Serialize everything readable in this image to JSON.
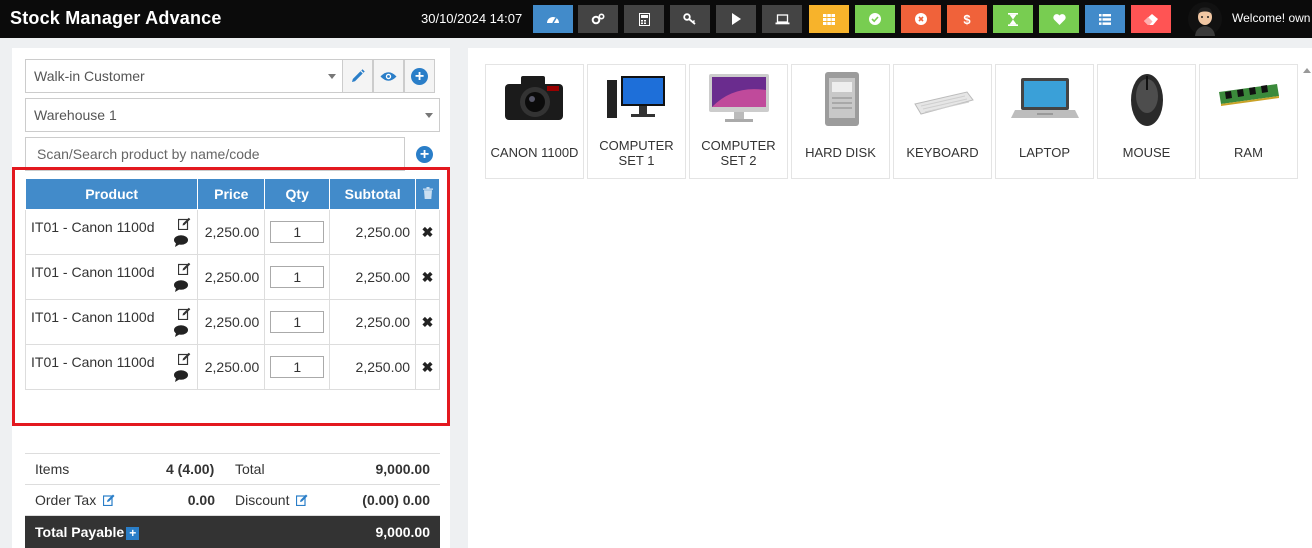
{
  "app": {
    "title": "Stock Manager Advance",
    "datetime": "30/10/2024 14:07",
    "welcome": "Welcome! own"
  },
  "toolbar": [
    {
      "icon": "dashboard-icon",
      "color": "#428bca"
    },
    {
      "icon": "cogs-icon",
      "color": "#444444"
    },
    {
      "icon": "calculator-icon",
      "color": "#444444"
    },
    {
      "icon": "key-icon",
      "color": "#444444"
    },
    {
      "icon": "play-icon",
      "color": "#444444"
    },
    {
      "icon": "laptop-icon",
      "color": "#444444"
    },
    {
      "icon": "th-icon",
      "color": "#f7b32b"
    },
    {
      "icon": "check-circle-icon",
      "color": "#78cd51"
    },
    {
      "icon": "times-circle-icon",
      "color": "#f0623a"
    },
    {
      "icon": "dollar-icon",
      "color": "#f0623a"
    },
    {
      "icon": "hourglass-icon",
      "color": "#78cd51"
    },
    {
      "icon": "heart-icon",
      "color": "#78cd51"
    },
    {
      "icon": "list-icon",
      "color": "#428bca"
    },
    {
      "icon": "eraser-icon",
      "color": "#ff5454"
    }
  ],
  "customer": {
    "value": "Walk-in Customer"
  },
  "warehouse": {
    "value": "Warehouse 1"
  },
  "search": {
    "placeholder": "Scan/Search product by name/code"
  },
  "cart": {
    "headers": {
      "product": "Product",
      "price": "Price",
      "qty": "Qty",
      "subtotal": "Subtotal"
    },
    "rows": [
      {
        "product": "IT01 - Canon 1100d",
        "price": "2,250.00",
        "qty": "1",
        "subtotal": "2,250.00"
      },
      {
        "product": "IT01 - Canon 1100d",
        "price": "2,250.00",
        "qty": "1",
        "subtotal": "2,250.00"
      },
      {
        "product": "IT01 - Canon 1100d",
        "price": "2,250.00",
        "qty": "1",
        "subtotal": "2,250.00"
      },
      {
        "product": "IT01 - Canon 1100d",
        "price": "2,250.00",
        "qty": "1",
        "subtotal": "2,250.00"
      }
    ],
    "remove_symbol": "✖"
  },
  "totals": {
    "items_label": "Items",
    "items_value": "4 (4.00)",
    "total_label": "Total",
    "total_value": "9,000.00",
    "order_tax_label": "Order Tax",
    "order_tax_value": "0.00",
    "discount_label": "Discount",
    "discount_value": "(0.00) 0.00",
    "total_payable_label": "Total Payable",
    "total_payable_value": "9,000.00"
  },
  "products": [
    {
      "name": "CANON 1100D"
    },
    {
      "name": "COMPUTER SET 1"
    },
    {
      "name": "COMPUTER SET 2"
    },
    {
      "name": "HARD DISK"
    },
    {
      "name": "KEYBOARD"
    },
    {
      "name": "LAPTOP"
    },
    {
      "name": "MOUSE"
    },
    {
      "name": "RAM"
    }
  ]
}
